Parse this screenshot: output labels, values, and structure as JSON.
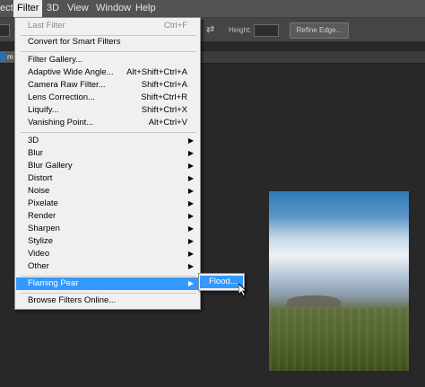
{
  "menubar": {
    "items": [
      {
        "label": "ect"
      },
      {
        "label": "Filter"
      },
      {
        "label": "3D"
      },
      {
        "label": "View"
      },
      {
        "label": "Window"
      },
      {
        "label": "Help"
      }
    ]
  },
  "options_bar": {
    "height_label": "Height:",
    "refine_edge_label": "Refine Edge..."
  },
  "doc_tab": {
    "label": "m"
  },
  "filter_menu": {
    "last_filter": {
      "label": "Last Filter",
      "shortcut": "Ctrl+F"
    },
    "convert_smart": {
      "label": "Convert for Smart Filters"
    },
    "filter_gallery": {
      "label": "Filter Gallery..."
    },
    "adaptive_wide_angle": {
      "label": "Adaptive Wide Angle...",
      "shortcut": "Alt+Shift+Ctrl+A"
    },
    "camera_raw": {
      "label": "Camera Raw Filter...",
      "shortcut": "Shift+Ctrl+A"
    },
    "lens_correction": {
      "label": "Lens Correction...",
      "shortcut": "Shift+Ctrl+R"
    },
    "liquify": {
      "label": "Liquify...",
      "shortcut": "Shift+Ctrl+X"
    },
    "vanishing_point": {
      "label": "Vanishing Point...",
      "shortcut": "Alt+Ctrl+V"
    },
    "submenus": [
      "3D",
      "Blur",
      "Blur Gallery",
      "Distort",
      "Noise",
      "Pixelate",
      "Render",
      "Sharpen",
      "Stylize",
      "Video",
      "Other"
    ],
    "flaming_pear": {
      "label": "Flaming Pear"
    },
    "browse_online": {
      "label": "Browse Filters Online..."
    }
  },
  "submenu": {
    "flood_label": "Flood..."
  },
  "colors": {
    "highlight": "#3399ff",
    "menu_bg": "#f0f0f0",
    "menubar_bg": "#535353",
    "canvas_bg": "#282828"
  }
}
